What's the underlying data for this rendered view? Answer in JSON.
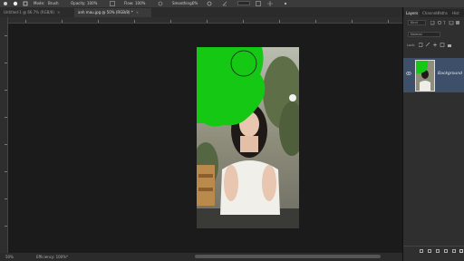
{
  "options_bar": {
    "mode_label": "Mode:",
    "mode_value": "Brush",
    "opacity_label": "Opacity:",
    "opacity_value": "100%",
    "flow_label": "Flow:",
    "flow_value": "100%",
    "smoothing_label": "Smoothing:",
    "smoothing_value": "0%"
  },
  "tabs": [
    {
      "label": "Untitled-1 @ 66.7% (RGB/8)",
      "active": false
    },
    {
      "label": "anh mau.jpg @ 50% (RGB/8) *",
      "active": true
    }
  ],
  "status": {
    "zoom": "50%",
    "efficiency_label": "Efficiency: 100%*"
  },
  "panel": {
    "tabs": [
      "Layers",
      "Channels",
      "Paths",
      "Hist"
    ],
    "active_tab": "Layers",
    "search_placeholder": "Kind",
    "blend_mode": "Normal",
    "lock_label": "Lock:",
    "layer_name": "Background"
  },
  "colors": {
    "accent_green": "#14c814",
    "layer_selected": "#3d4f69",
    "workspace": "#1b1b1b"
  }
}
